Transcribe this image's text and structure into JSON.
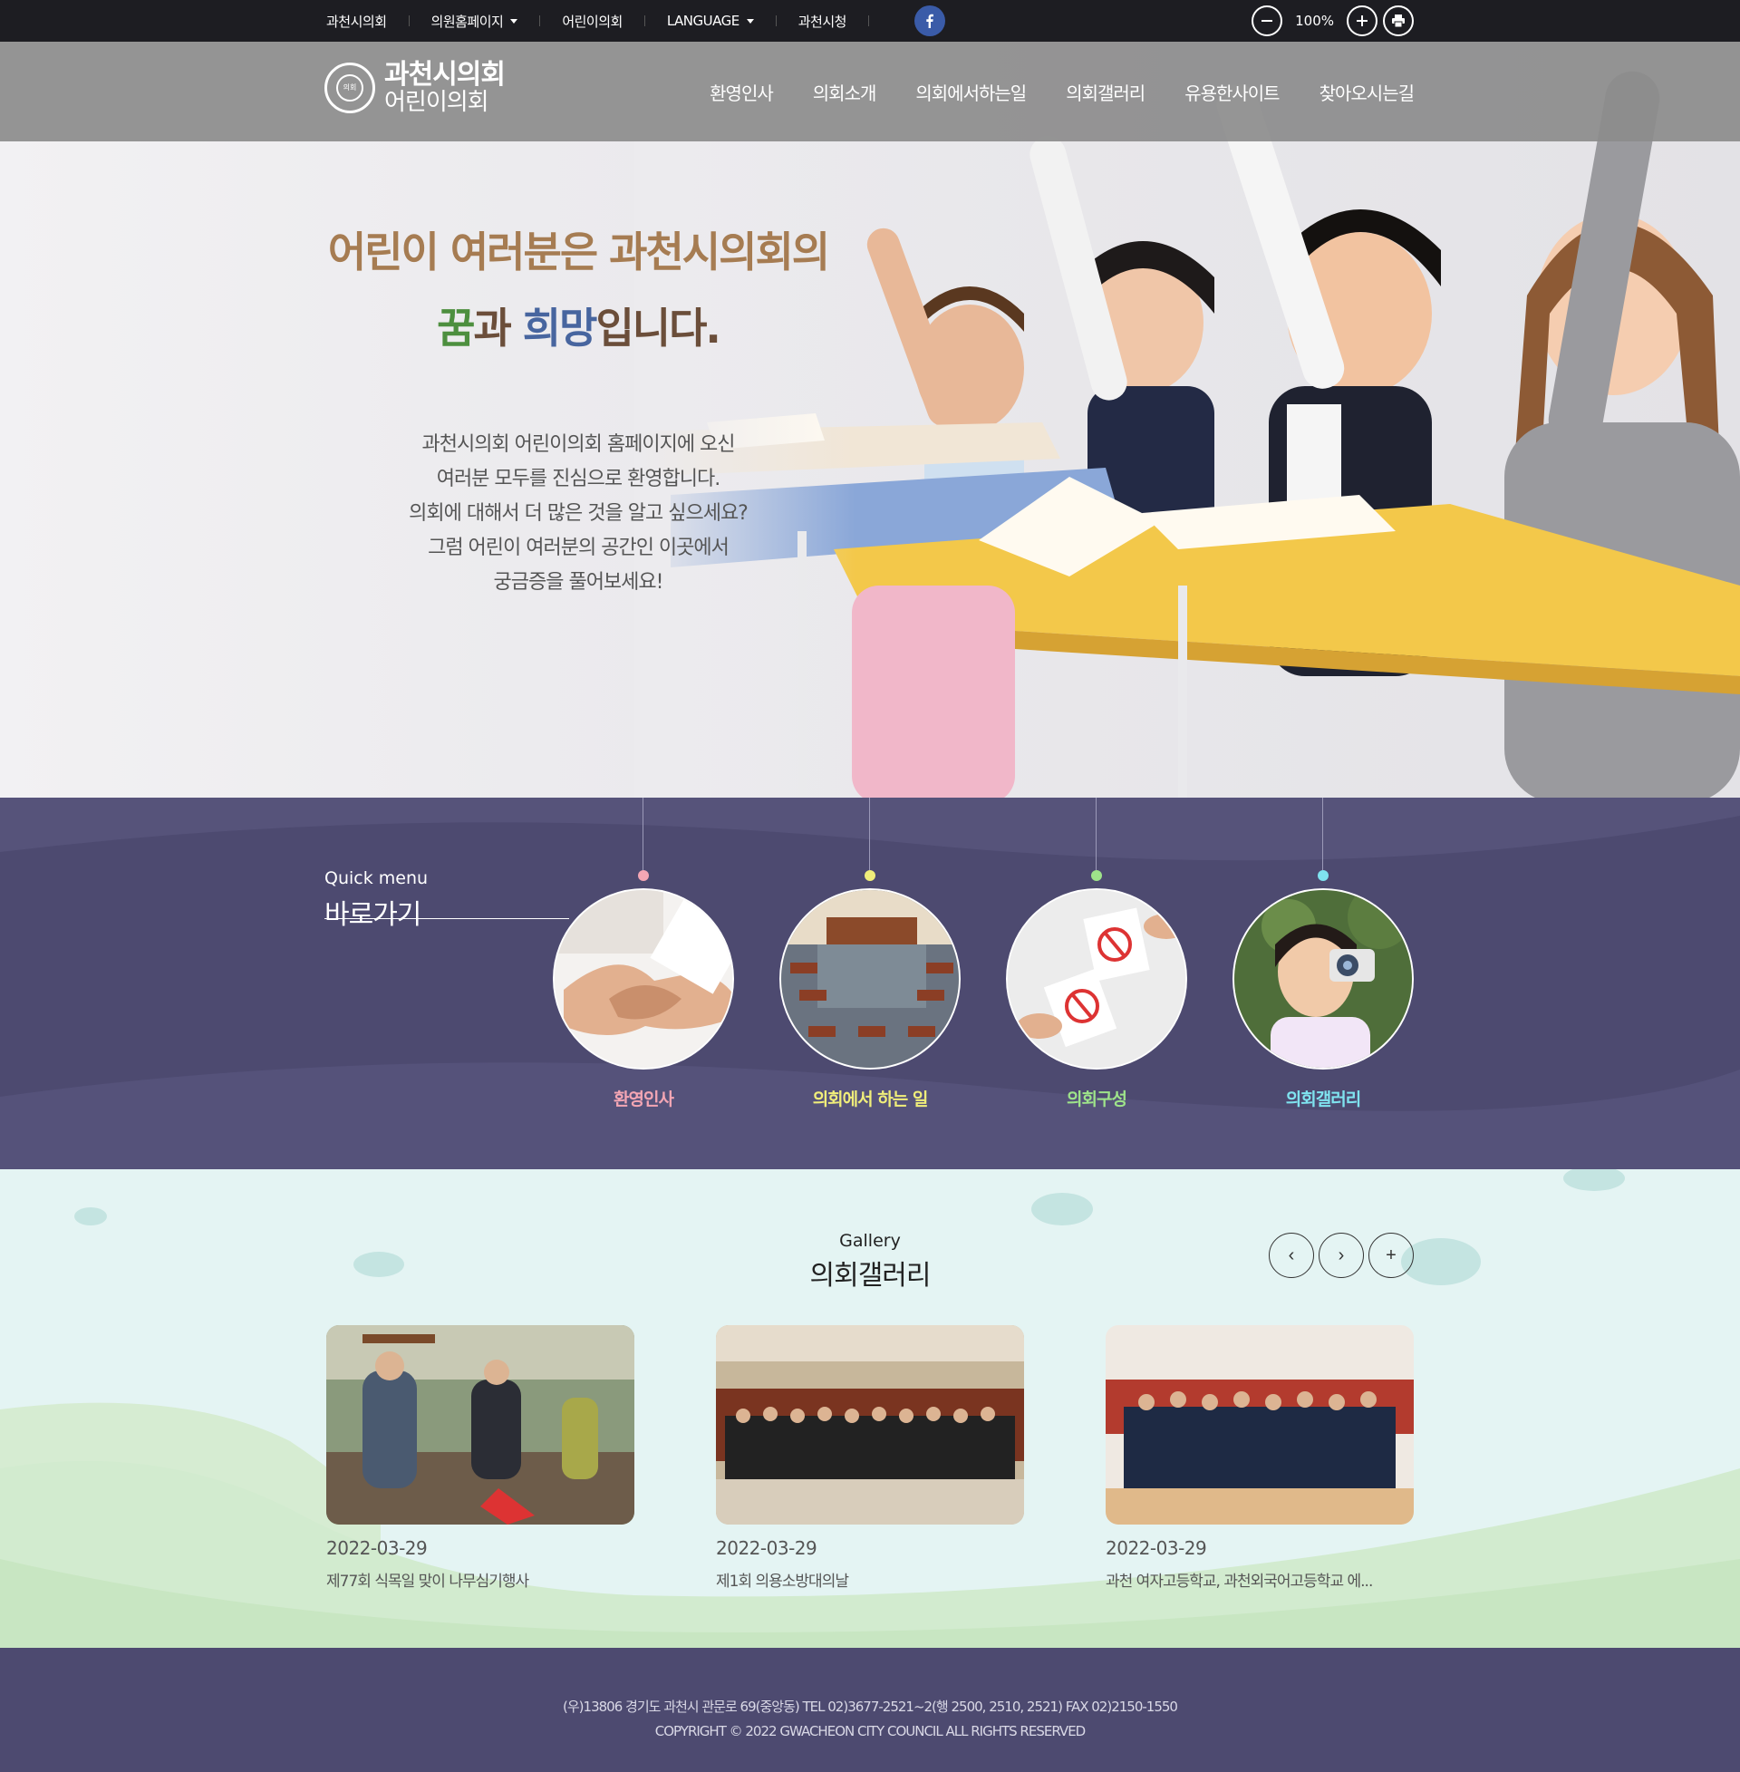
{
  "util": {
    "links": [
      {
        "label": "과천시의회",
        "dropdown": false
      },
      {
        "label": "의원홈페이지",
        "dropdown": true
      },
      {
        "label": "어린이의회",
        "dropdown": false
      },
      {
        "label": "LANGUAGE",
        "dropdown": true
      },
      {
        "label": "과천시청",
        "dropdown": false
      }
    ],
    "zoom": "100%",
    "facebook_icon": "facebook-icon",
    "colors": {
      "bar": "#1d1d22",
      "facebook": "#3a5ba8"
    }
  },
  "header": {
    "logo_line1": "과천시의회",
    "logo_line2": "어린이의회",
    "seal_text": "의회",
    "nav": [
      "환영인사",
      "의회소개",
      "의회에서하는일",
      "의회갤러리",
      "유용한사이트",
      "찾아오시는길"
    ]
  },
  "hero": {
    "title_line1": "어린이 여러분은 과천시의회의",
    "title_dream": "꿈",
    "title_and": "과 ",
    "title_hope": "희망",
    "title_end": "입니다.",
    "desc": [
      "과천시의회 어린이의회 홈페이지에 오신",
      "여러분 모두를 진심으로 환영합니다.",
      "의회에 대해서 더 많은 것을 알고 싶으세요?",
      "그럼 어린이 여러분의 공간인 이곳에서",
      "궁금증을 풀어보세요!"
    ],
    "colors": {
      "title": "#a67c52",
      "dream": "#4d8f3f",
      "hope": "#47659f"
    }
  },
  "quick": {
    "sub": "Quick menu",
    "title": "바로가기",
    "items": [
      {
        "label": "환영인사",
        "color": "#f4a6b4"
      },
      {
        "label": "의회에서 하는 일",
        "color": "#f0ee7a"
      },
      {
        "label": "의회구성",
        "color": "#9ee38a"
      },
      {
        "label": "의회갤러리",
        "color": "#7fe3ef"
      }
    ],
    "bg": "#4d4a70"
  },
  "gallery": {
    "sub": "Gallery",
    "title": "의회갤러리",
    "prev": "‹",
    "next": "›",
    "more": "+",
    "items": [
      {
        "date": "2022-03-29",
        "title": "제77회 식목일 맞이 나무심기행사"
      },
      {
        "date": "2022-03-29",
        "title": "제1회 의용소방대의날"
      },
      {
        "date": "2022-03-29",
        "title": "과천 여자고등학교, 과천외국어고등학교 에..."
      }
    ],
    "bg": "#e4f4f3"
  },
  "footer": {
    "address": "(우)13806 경기도 과천시 관문로 69(중앙동) TEL 02)3677-2521~2(행 2500, 2510, 2521) FAX 02)2150-1550",
    "copyright": "COPYRIGHT © 2022 GWACHEON CITY COUNCIL ALL RIGHTS RESERVED"
  }
}
